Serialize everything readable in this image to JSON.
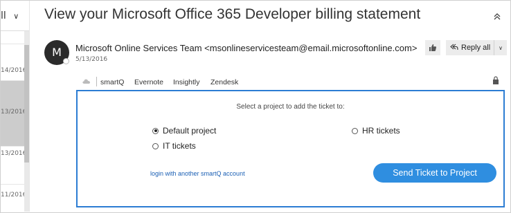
{
  "message_list": {
    "filter_label": "ll",
    "dates": [
      "14/2016",
      "13/2016",
      "13/2016",
      "11/2016"
    ]
  },
  "email": {
    "subject": "View your Microsoft Office 365 Developer billing statement",
    "avatar_initial": "M",
    "sender": "Microsoft Online Services Team <msonlineservicesteam@email.microsoftonline.com>",
    "date": "5/13/2016",
    "actions": {
      "reply_all_label": "Reply all"
    }
  },
  "addins": {
    "tabs": [
      "smartQ",
      "Evernote",
      "Insightly",
      "Zendesk"
    ],
    "active_tab": "smartQ"
  },
  "smartq": {
    "prompt": "Select a project to add the ticket to:",
    "projects": [
      {
        "label": "Default project",
        "checked": true
      },
      {
        "label": "IT tickets",
        "checked": false
      },
      {
        "label": "HR tickets",
        "checked": false
      }
    ],
    "login_link": "login with another smartQ account",
    "send_button": "Send Ticket to Project"
  },
  "colors": {
    "accent": "#2b7cd3",
    "button": "#2f8ee0",
    "link": "#1a5fb4",
    "selected_row": "#cccccc"
  }
}
